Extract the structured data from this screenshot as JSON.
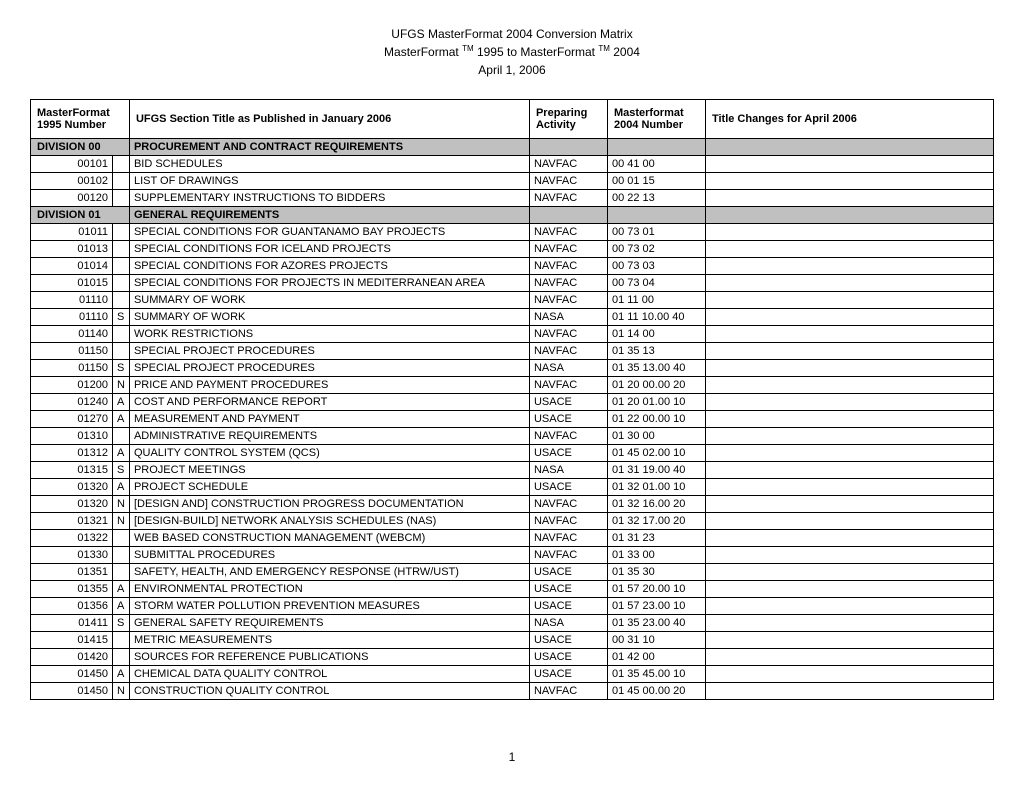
{
  "title": {
    "line1": "UFGS MasterFormat 2004 Conversion Matrix",
    "line2_a": "MasterFormat ",
    "line2_tm": "TM",
    "line2_b": " 1995 to MasterFormat ",
    "line2_tm2": "TM",
    "line2_c": " 2004",
    "line3": "April 1, 2006"
  },
  "headers": {
    "col1": "MasterFormat 1995 Number",
    "col3": "UFGS Section Title as Published in January 2006",
    "col4": "Preparing Activity",
    "col5": "Masterformat 2004 Number",
    "col6": "Title Changes for April 2006"
  },
  "rows": [
    {
      "div": true,
      "num": "DIVISION 00",
      "sfx": "",
      "title": "PROCUREMENT AND CONTRACT REQUIREMENTS",
      "act": "",
      "n2004": "",
      "chg": ""
    },
    {
      "div": false,
      "num": "00101",
      "sfx": "",
      "title": "BID SCHEDULES",
      "act": "NAVFAC",
      "n2004": "00 41 00",
      "chg": ""
    },
    {
      "div": false,
      "num": "00102",
      "sfx": "",
      "title": "LIST OF DRAWINGS",
      "act": "NAVFAC",
      "n2004": "00 01 15",
      "chg": ""
    },
    {
      "div": false,
      "num": "00120",
      "sfx": "",
      "title": "SUPPLEMENTARY INSTRUCTIONS TO BIDDERS",
      "act": "NAVFAC",
      "n2004": "00 22 13",
      "chg": ""
    },
    {
      "div": true,
      "num": "DIVISION 01",
      "sfx": "",
      "title": "GENERAL REQUIREMENTS",
      "act": "",
      "n2004": "",
      "chg": ""
    },
    {
      "div": false,
      "num": "01011",
      "sfx": "",
      "title": "SPECIAL CONDITIONS FOR GUANTANAMO BAY PROJECTS",
      "act": "NAVFAC",
      "n2004": "00 73 01",
      "chg": ""
    },
    {
      "div": false,
      "num": "01013",
      "sfx": "",
      "title": "SPECIAL CONDITIONS FOR ICELAND PROJECTS",
      "act": "NAVFAC",
      "n2004": "00 73 02",
      "chg": ""
    },
    {
      "div": false,
      "num": "01014",
      "sfx": "",
      "title": "SPECIAL CONDITIONS FOR AZORES PROJECTS",
      "act": "NAVFAC",
      "n2004": "00 73 03",
      "chg": ""
    },
    {
      "div": false,
      "num": "01015",
      "sfx": "",
      "title": "SPECIAL CONDITIONS FOR PROJECTS IN  MEDITERRANEAN AREA",
      "act": "NAVFAC",
      "n2004": "00 73 04",
      "chg": ""
    },
    {
      "div": false,
      "num": "01110",
      "sfx": "",
      "title": "SUMMARY OF WORK",
      "act": "NAVFAC",
      "n2004": "01 11 00",
      "chg": ""
    },
    {
      "div": false,
      "num": "01110",
      "sfx": "S",
      "title": "SUMMARY OF WORK",
      "act": "NASA",
      "n2004": "01 11 10.00 40",
      "chg": ""
    },
    {
      "div": false,
      "num": "01140",
      "sfx": "",
      "title": "WORK RESTRICTIONS",
      "act": "NAVFAC",
      "n2004": "01 14 00",
      "chg": ""
    },
    {
      "div": false,
      "num": "01150",
      "sfx": "",
      "title": "SPECIAL PROJECT PROCEDURES",
      "act": "NAVFAC",
      "n2004": "01 35 13",
      "chg": ""
    },
    {
      "div": false,
      "num": "01150",
      "sfx": "S",
      "title": "SPECIAL PROJECT PROCEDURES",
      "act": "NASA",
      "n2004": "01 35 13.00 40",
      "chg": ""
    },
    {
      "div": false,
      "num": "01200",
      "sfx": "N",
      "title": "PRICE AND PAYMENT PROCEDURES",
      "act": "NAVFAC",
      "n2004": "01 20 00.00 20",
      "chg": ""
    },
    {
      "div": false,
      "num": "01240",
      "sfx": "A",
      "title": "COST AND PERFORMANCE REPORT",
      "act": "USACE",
      "n2004": "01 20 01.00 10",
      "chg": ""
    },
    {
      "div": false,
      "num": "01270",
      "sfx": "A",
      "title": "MEASUREMENT AND PAYMENT",
      "act": "USACE",
      "n2004": "01 22 00.00 10",
      "chg": ""
    },
    {
      "div": false,
      "num": "01310",
      "sfx": "",
      "title": "ADMINISTRATIVE REQUIREMENTS",
      "act": "NAVFAC",
      "n2004": "01 30 00",
      "chg": ""
    },
    {
      "div": false,
      "num": "01312",
      "sfx": "A",
      "title": "QUALITY CONTROL SYSTEM (QCS)",
      "act": "USACE",
      "n2004": "01 45 02.00 10",
      "chg": ""
    },
    {
      "div": false,
      "num": "01315",
      "sfx": "S",
      "title": "PROJECT MEETINGS",
      "act": "NASA",
      "n2004": "01 31 19.00 40",
      "chg": ""
    },
    {
      "div": false,
      "num": "01320",
      "sfx": "A",
      "title": "PROJECT SCHEDULE",
      "act": "USACE",
      "n2004": "01 32 01.00 10",
      "chg": ""
    },
    {
      "div": false,
      "num": "01320",
      "sfx": "N",
      "title": "[DESIGN AND] CONSTRUCTION PROGRESS DOCUMENTATION",
      "act": "NAVFAC",
      "n2004": "01 32 16.00 20",
      "chg": ""
    },
    {
      "div": false,
      "num": "01321",
      "sfx": "N",
      "title": "[DESIGN-BUILD] NETWORK ANALYSIS SCHEDULES (NAS)",
      "act": "NAVFAC",
      "n2004": "01 32 17.00 20",
      "chg": ""
    },
    {
      "div": false,
      "num": "01322",
      "sfx": "",
      "title": "WEB BASED CONSTRUCTION MANAGEMENT (WEBCM)",
      "act": "NAVFAC",
      "n2004": "01 31 23",
      "chg": ""
    },
    {
      "div": false,
      "num": "01330",
      "sfx": "",
      "title": "SUBMITTAL PROCEDURES",
      "act": "NAVFAC",
      "n2004": "01 33 00",
      "chg": ""
    },
    {
      "div": false,
      "num": "01351",
      "sfx": "",
      "title": "SAFETY, HEALTH, AND EMERGENCY RESPONSE (HTRW/UST)",
      "act": "USACE",
      "n2004": "01 35 30",
      "chg": ""
    },
    {
      "div": false,
      "num": "01355",
      "sfx": "A",
      "title": "ENVIRONMENTAL PROTECTION",
      "act": "USACE",
      "n2004": "01 57 20.00 10",
      "chg": ""
    },
    {
      "div": false,
      "num": "01356",
      "sfx": "A",
      "title": "STORM WATER POLLUTION PREVENTION MEASURES",
      "act": "USACE",
      "n2004": "01 57 23.00 10",
      "chg": ""
    },
    {
      "div": false,
      "num": "01411",
      "sfx": "S",
      "title": "GENERAL SAFETY REQUIREMENTS",
      "act": "NASA",
      "n2004": "01 35 23.00 40",
      "chg": ""
    },
    {
      "div": false,
      "num": "01415",
      "sfx": "",
      "title": "METRIC MEASUREMENTS",
      "act": "USACE",
      "n2004": "00 31 10",
      "chg": ""
    },
    {
      "div": false,
      "num": "01420",
      "sfx": "",
      "title": "SOURCES FOR REFERENCE PUBLICATIONS",
      "act": "USACE",
      "n2004": "01 42 00",
      "chg": ""
    },
    {
      "div": false,
      "num": "01450",
      "sfx": "A",
      "title": "CHEMICAL DATA QUALITY CONTROL",
      "act": "USACE",
      "n2004": "01 35 45.00 10",
      "chg": ""
    },
    {
      "div": false,
      "num": "01450",
      "sfx": "N",
      "title": "CONSTRUCTION QUALITY CONTROL",
      "act": "NAVFAC",
      "n2004": "01 45 00.00 20",
      "chg": ""
    }
  ],
  "page": "1"
}
